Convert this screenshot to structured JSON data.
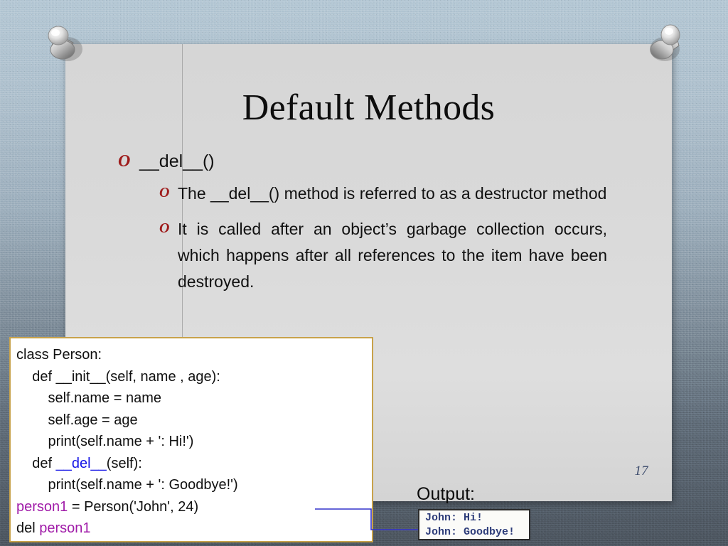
{
  "slide": {
    "title": "Default Methods",
    "number": "17",
    "bullets": [
      {
        "level": 1,
        "glyph": "O",
        "text": "__del__()"
      },
      {
        "level": 2,
        "glyph": "O",
        "text": "The __del__() method is referred to as a destructor method"
      },
      {
        "level": 2,
        "glyph": "O",
        "text": "It is called after an object’s garbage collection occurs, which happens after all references to the item have been destroyed."
      }
    ]
  },
  "code_box": {
    "lines": [
      "class Person:",
      "    def __init__(self, name , age):",
      "        self.name = name",
      "        self.age = age",
      "        print(self.name + ': Hi!')",
      "    def __del__(self):",
      "        print(self.name + ': Goodbye!')",
      "person1 = Person('John', 24)",
      "del person1"
    ],
    "highlight_del": "__del__",
    "highlight_var": "person1",
    "border_color": "#c8a24a",
    "del_color": "#1414e6",
    "var_color": "#a01ba8"
  },
  "output": {
    "label": "Output:",
    "lines": [
      "John: Hi!",
      "John: Goodbye!"
    ],
    "text_color": "#2e3d7a"
  },
  "connector": {
    "color": "#3333cc",
    "shape": "elbow-arrow-right"
  },
  "decor": {
    "pin_left": "pushpin-icon",
    "pin_right": "pushpin-icon",
    "background": "textured-board"
  }
}
